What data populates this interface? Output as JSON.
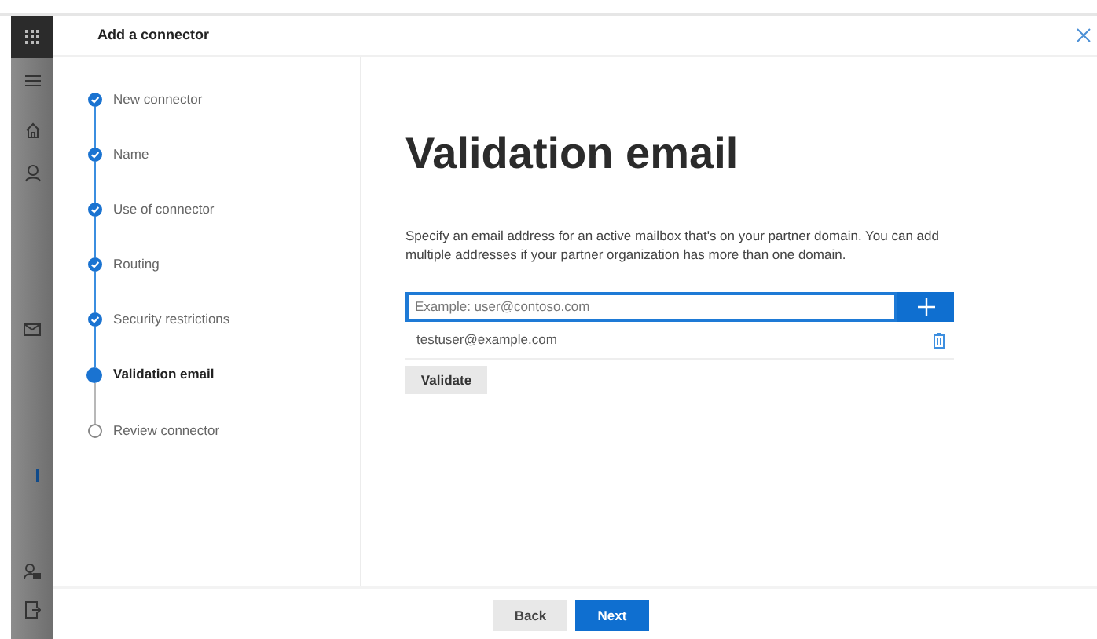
{
  "panel": {
    "title": "Add a connector"
  },
  "steps": [
    {
      "label": "New connector",
      "completed": true,
      "selected": false
    },
    {
      "label": "Name",
      "completed": true,
      "selected": false
    },
    {
      "label": "Use of connector",
      "completed": true,
      "selected": false
    },
    {
      "label": "Routing",
      "completed": true,
      "selected": false
    },
    {
      "label": "Security restrictions",
      "completed": true,
      "selected": false
    },
    {
      "label": "Validation email",
      "completed": false,
      "selected": true
    },
    {
      "label": "Review connector",
      "completed": false,
      "selected": false
    }
  ],
  "content": {
    "heading": "Validation email",
    "description": "Specify an email address for an active mailbox that's on your partner domain. You can add multiple addresses if your partner organization has more than one domain.",
    "email_field": {
      "placeholder": "Example: user@contoso.com"
    },
    "addresses": [
      "testuser@example.com"
    ],
    "validate_button": "Validate"
  },
  "footer": {
    "buttons": [
      {
        "label": "Back",
        "kind": "secondary"
      },
      {
        "label": "Next",
        "kind": "primary"
      }
    ]
  }
}
